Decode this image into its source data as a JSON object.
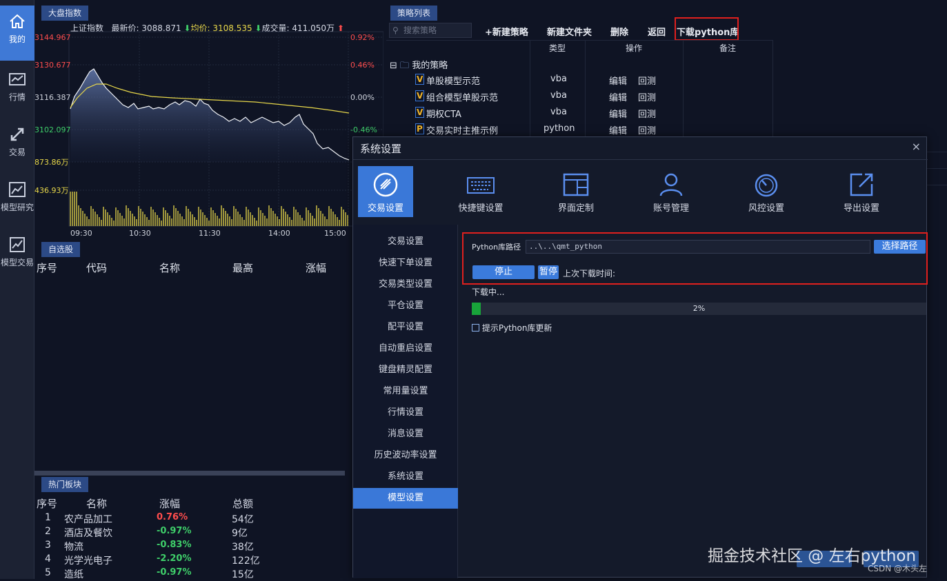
{
  "nav": {
    "items": [
      {
        "label": "我的",
        "icon": "home-icon"
      },
      {
        "label": "行情",
        "icon": "chart-icon"
      },
      {
        "label": "交易",
        "icon": "trade-arrows-icon"
      },
      {
        "label": "模型研究",
        "icon": "model-research-icon"
      },
      {
        "label": "模型交易",
        "icon": "model-trade-icon"
      }
    ]
  },
  "index_panel": {
    "tab": "大盘指数",
    "name": "上证指数",
    "latest_label": "最新价:",
    "latest": "3088.871",
    "avg_label": "均价:",
    "avg": "3108.535",
    "volume_label": "成交量:",
    "volume": "411.050万",
    "y_labels": [
      "3144.967",
      "3130.677",
      "3116.387",
      "3102.097"
    ],
    "pct_labels": [
      "0.92%",
      "0.46%",
      "0.00%",
      "-0.46%"
    ],
    "vol_labels": [
      "873.86万",
      "436.93万"
    ],
    "time_labels": [
      "09:30",
      "10:30",
      "11:30",
      "14:00",
      "15:00"
    ],
    "colors": {
      "up": "#ff4d4d",
      "neutral": "#cfd3dc",
      "down": "#3fcf6a",
      "vol": "#e8d84a"
    }
  },
  "watchlist": {
    "tab": "自选股",
    "headers": [
      "序号",
      "代码",
      "名称",
      "最高",
      "涨幅"
    ]
  },
  "hot_sectors": {
    "tab": "热门板块",
    "headers": [
      "序号",
      "名称",
      "涨幅",
      "总额"
    ],
    "rows": [
      {
        "no": "1",
        "name": "农产品加工",
        "change": "0.76%",
        "total": "54亿",
        "dir": "up"
      },
      {
        "no": "2",
        "name": "酒店及餐饮",
        "change": "-0.97%",
        "total": "9亿",
        "dir": "down"
      },
      {
        "no": "3",
        "name": "物流",
        "change": "-0.83%",
        "total": "38亿",
        "dir": "down"
      },
      {
        "no": "4",
        "name": "光学光电子",
        "change": "-2.20%",
        "total": "122亿",
        "dir": "down"
      },
      {
        "no": "5",
        "name": "造纸",
        "change": "-0.97%",
        "total": "15亿",
        "dir": "down"
      }
    ]
  },
  "strategy": {
    "tab": "策略列表",
    "search_placeholder": "搜索策略",
    "toolbar": {
      "new_strategy": "+新建策略",
      "new_folder": "新建文件夹",
      "delete": "删除",
      "back": "返回",
      "download_python": "下载python库"
    },
    "columns": {
      "type": "类型",
      "action": "操作",
      "note": "备注"
    },
    "folder": "我的策略",
    "rows": [
      {
        "name": "单股模型示范",
        "type": "vba",
        "edit": "编辑",
        "test": "回测",
        "badge": "V"
      },
      {
        "name": "组合模型单股示范",
        "type": "vba",
        "edit": "编辑",
        "test": "回测",
        "badge": "V"
      },
      {
        "name": "期权CTA",
        "type": "vba",
        "edit": "编辑",
        "test": "回测",
        "badge": "V"
      },
      {
        "name": "交易实时主推示例",
        "type": "python",
        "edit": "编辑",
        "test": "回测",
        "badge": "P"
      }
    ]
  },
  "dialog": {
    "title": "系统设置",
    "close": "×",
    "tabs": [
      {
        "label": "交易设置",
        "icon": "trade-settings-icon"
      },
      {
        "label": "快捷键设置",
        "icon": "keyboard-icon"
      },
      {
        "label": "界面定制",
        "icon": "layout-icon"
      },
      {
        "label": "账号管理",
        "icon": "user-icon"
      },
      {
        "label": "风控设置",
        "icon": "gauge-icon"
      },
      {
        "label": "导出设置",
        "icon": "export-icon"
      }
    ],
    "sidebar": [
      "交易设置",
      "快速下单设置",
      "交易类型设置",
      "平仓设置",
      "配平设置",
      "自动重启设置",
      "键盘精灵配置",
      "常用量设置",
      "行情设置",
      "消息设置",
      "历史波动率设置",
      "系统设置",
      "模型设置"
    ],
    "python_path_label": "Python库路径",
    "python_path_value": "..\\..\\qmt_python",
    "choose_path": "选择路径",
    "stop": "停止",
    "pause": "暂停",
    "last_download": "上次下载时间:",
    "downloading": "下载中...",
    "progress": 0.02,
    "progress_text": "2%",
    "remind_label": "提示Python库更新"
  },
  "watermark": {
    "text": "掘金技术社区 @ 左右python",
    "small": "CSDN @木头左"
  }
}
